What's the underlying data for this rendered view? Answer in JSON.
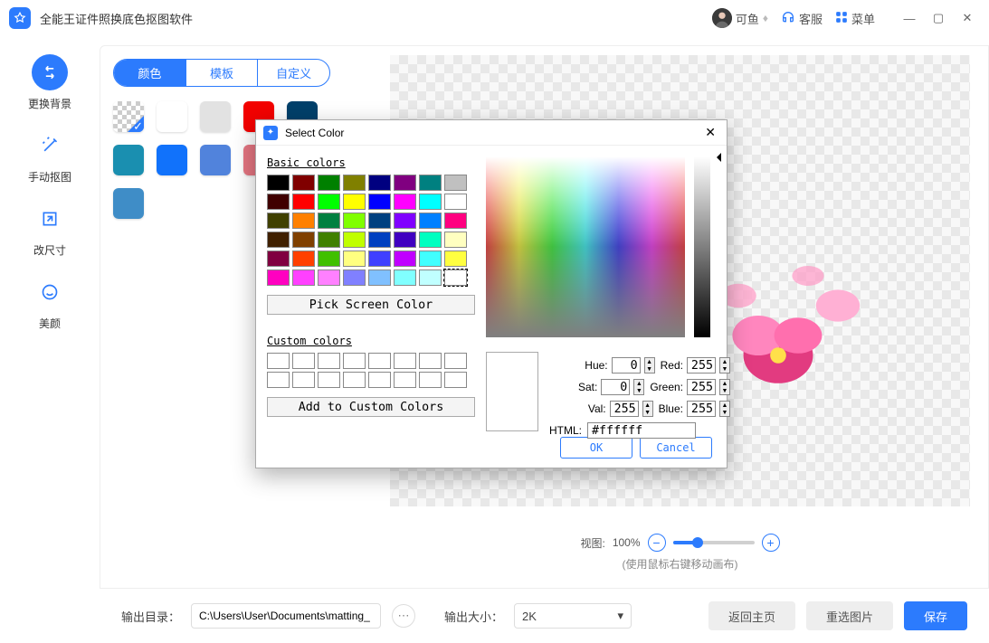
{
  "app": {
    "title": "全能王证件照换底色抠图软件",
    "user": "可鱼",
    "kefu": "客服",
    "menu": "菜单"
  },
  "nav": {
    "bg": "更换背景",
    "manual": "手动抠图",
    "resize": "改尺寸",
    "beauty": "美颜"
  },
  "tabs": {
    "color": "颜色",
    "template": "模板",
    "custom": "自定义"
  },
  "swatches": [
    "transparent",
    "#ffffff",
    "#e2e2e2",
    "#f30200",
    "#00406a",
    "#1a8fb0",
    "#1172fb",
    "#5183dc",
    "#e47581",
    "#3c64a0",
    "#3f8dc7"
  ],
  "preview": {
    "zoom_label": "视图:",
    "zoom_value": "100%",
    "zoom_hint": "(使用鼠标右键移动画布)"
  },
  "bottom": {
    "outdir_label": "输出目录：",
    "outdir_value": "C:\\Users\\User\\Documents\\matting_",
    "outsize_label": "输出大小：",
    "outsize_value": "2K",
    "back": "返回主页",
    "reset": "重选图片",
    "save": "保存"
  },
  "dialog": {
    "title": "Select Color",
    "basic_label": "Basic colors",
    "basic_colors": [
      "#000000",
      "#800000",
      "#008000",
      "#808000",
      "#000080",
      "#800080",
      "#008080",
      "#c0c0c0",
      "#400000",
      "#ff0000",
      "#00ff00",
      "#ffff00",
      "#0000ff",
      "#ff00ff",
      "#00ffff",
      "#ffffff",
      "#404000",
      "#ff8000",
      "#008040",
      "#80ff00",
      "#004080",
      "#8000ff",
      "#0080ff",
      "#ff0080",
      "#402000",
      "#804000",
      "#408000",
      "#c0ff00",
      "#0040c0",
      "#4000c0",
      "#00ffc0",
      "#ffffc0",
      "#800040",
      "#ff4000",
      "#40c000",
      "#ffff80",
      "#4040ff",
      "#c000ff",
      "#40ffff",
      "#ffff40",
      "#ff00c0",
      "#ff40ff",
      "#ff80ff",
      "#8080ff",
      "#80c0ff",
      "#80ffff",
      "#c0ffff",
      "#ffffff"
    ],
    "pick": "Pick Screen Color",
    "custom_label": "Custom colors",
    "addcustom": "Add to Custom Colors",
    "hue_l": "Hue:",
    "hue_v": "0",
    "sat_l": "Sat:",
    "sat_v": "0",
    "val_l": "Val:",
    "val_v": "255",
    "red_l": "Red:",
    "red_v": "255",
    "green_l": "Green:",
    "green_v": "255",
    "blue_l": "Blue:",
    "blue_v": "255",
    "html_l": "HTML:",
    "html_v": "#ffffff",
    "ok": "OK",
    "cancel": "Cancel"
  }
}
